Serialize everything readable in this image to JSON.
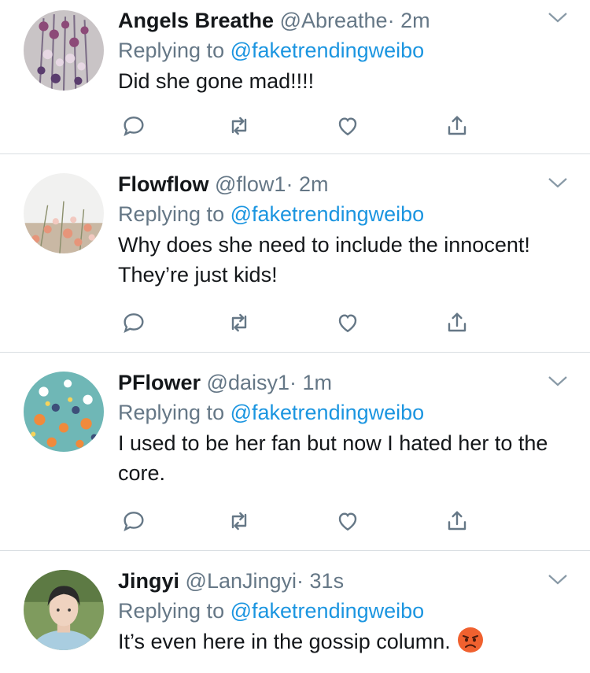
{
  "colors": {
    "text": "#14171a",
    "secondary": "#657786",
    "link": "#1b95e0",
    "divider": "#d9dee2"
  },
  "icons": [
    "chevron-down-icon",
    "reply-icon",
    "retweet-icon",
    "like-icon",
    "share-icon"
  ],
  "tweets": [
    {
      "name": "Angels Breathe",
      "handle": "@Abreathe",
      "time": "· 2m",
      "replying_prefix": "Replying to",
      "replying_to": "@faketrendingweibo",
      "text": "Did she gone mad!!!!"
    },
    {
      "name": "Flowflow",
      "handle": "@flow1",
      "time": "· 2m",
      "replying_prefix": "Replying to",
      "replying_to": "@faketrendingweibo",
      "text": "Why does she need to include the innocent! They’re just kids!"
    },
    {
      "name": "PFlower",
      "handle": "@daisy1",
      "time": "· 1m",
      "replying_prefix": "Replying to",
      "replying_to": "@faketrendingweibo",
      "text": "I used to be her fan but now I hated her to the core."
    },
    {
      "name": "Jingyi",
      "handle": "@LanJingyi",
      "time": "· 31s",
      "replying_prefix": "Replying to",
      "replying_to": "@faketrendingweibo",
      "text": "It’s even here in the gossip column.",
      "emoji": "angry-face-emoji"
    }
  ]
}
